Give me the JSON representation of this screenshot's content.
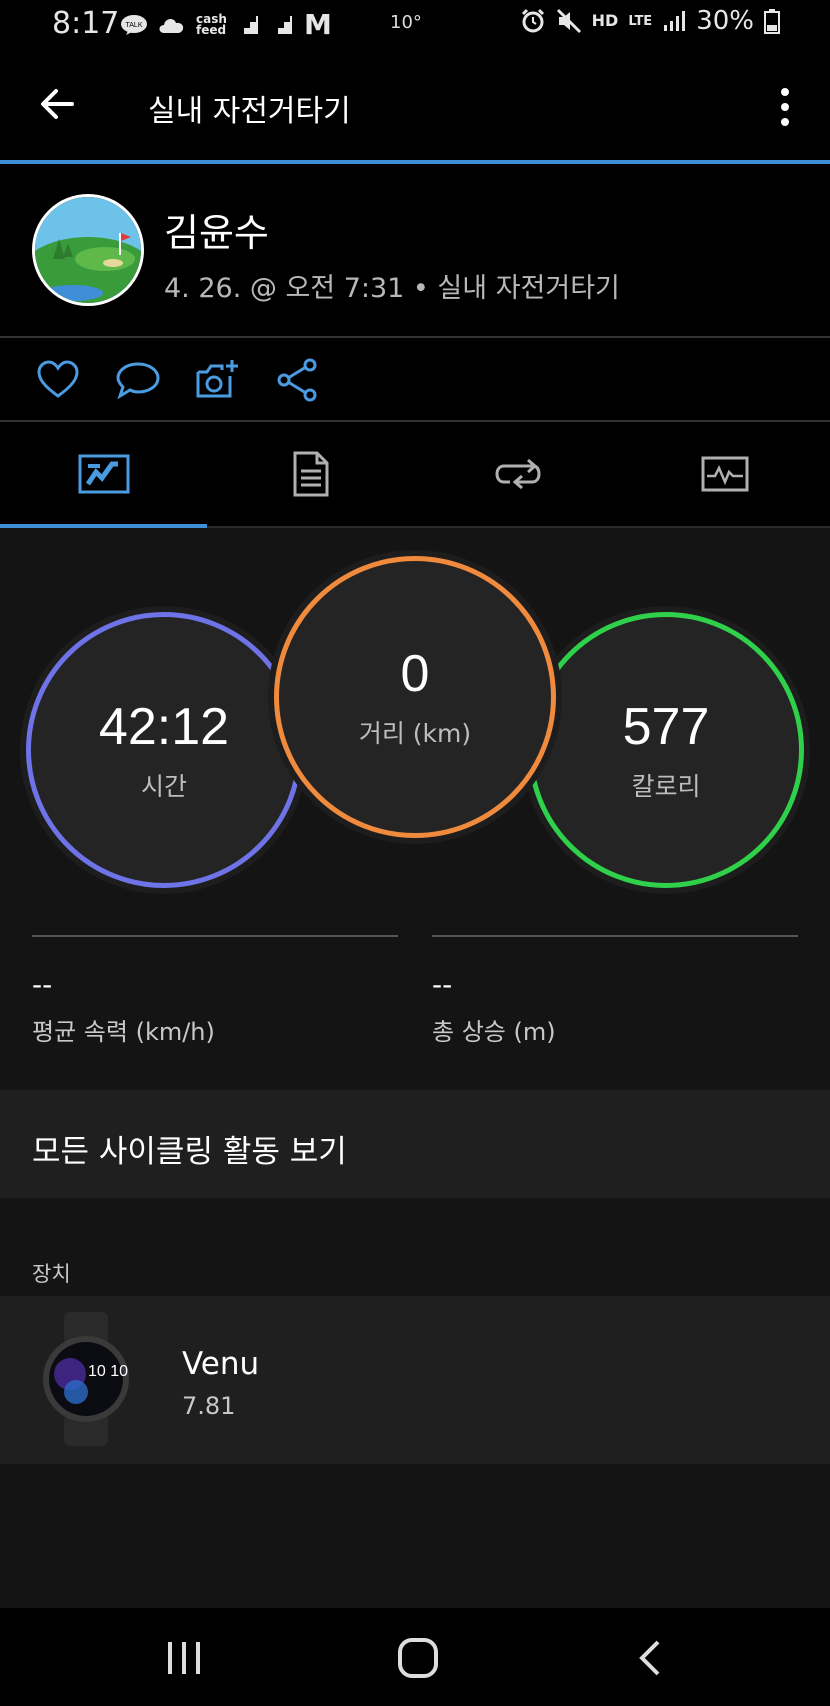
{
  "status_bar": {
    "time": "8:17",
    "temperature": "10°",
    "left_icons": [
      "TALK",
      "cash feed",
      "M"
    ],
    "hd_label": "HD",
    "lte_label": "LTE",
    "battery": "30%"
  },
  "toolbar": {
    "title": "실내 자전거타기"
  },
  "profile": {
    "name": "김윤수",
    "meta": "4. 26. @ 오전 7:31 • 실내 자전거타기"
  },
  "actions": [
    "heart-icon",
    "comment-icon",
    "camera-icon",
    "share-icon"
  ],
  "tabs": [
    "summary-tab",
    "details-tab",
    "laps-tab",
    "chart-tab"
  ],
  "stats": {
    "time": {
      "value": "42:12",
      "label": "시간",
      "color": "#6f73e8"
    },
    "distance": {
      "value": "0",
      "label": "거리 (km)",
      "color": "#f08a3c"
    },
    "calories": {
      "value": "577",
      "label": "칼로리",
      "color": "#2fd14a"
    }
  },
  "metrics": [
    {
      "value": "--",
      "label": "평균 속력 (km/h)"
    },
    {
      "value": "--",
      "label": "총 상승 (m)"
    }
  ],
  "view_all": "모든 사이클링 활동 보기",
  "device": {
    "heading": "장치",
    "name": "Venu",
    "version": "7.81",
    "watch_face": "10 10"
  },
  "colors": {
    "accent": "#3d8fd6",
    "background": "#000000",
    "panel": "#1f1f1f"
  }
}
